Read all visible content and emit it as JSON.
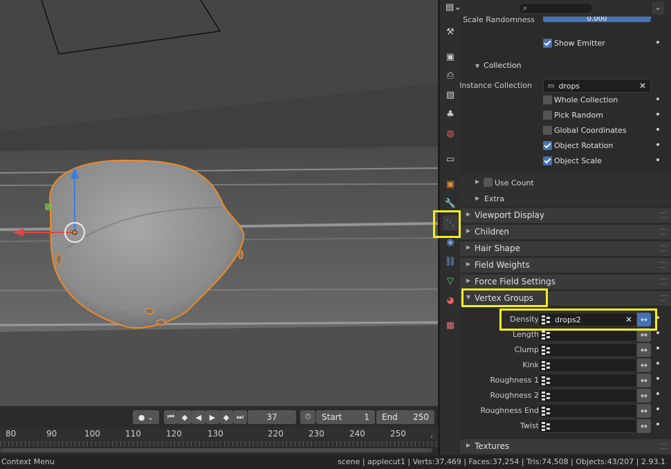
{
  "header": {
    "editor_icon": "properties-editor-icon",
    "search_placeholder": ""
  },
  "props": {
    "scale_randomness_label": "Scale Randomness",
    "scale_randomness_value": "0.000",
    "show_emitter": {
      "label": "Show Emitter",
      "checked": true
    },
    "collection_title": "Collection",
    "instance_collection": {
      "label": "Instance Collection",
      "value": "drops"
    },
    "checks": [
      {
        "label": "Whole Collection",
        "checked": false
      },
      {
        "label": "Pick Random",
        "checked": false
      },
      {
        "label": "Global Coordinates",
        "checked": false
      },
      {
        "label": "Object Rotation",
        "checked": true
      },
      {
        "label": "Object Scale",
        "checked": true
      }
    ],
    "use_count": {
      "label": "Use Count",
      "checked": false
    },
    "extra": "Extra",
    "panels_top": [
      "Viewport Display",
      "Children",
      "Hair Shape",
      "Field Weights",
      "Force Field Settings"
    ],
    "vertex_groups_title": "Vertex Groups",
    "vg_rows": [
      {
        "label": "Density",
        "value": "drops2"
      },
      {
        "label": "Length",
        "value": ""
      },
      {
        "label": "Clump",
        "value": ""
      },
      {
        "label": "Kink",
        "value": ""
      },
      {
        "label": "Roughness 1",
        "value": ""
      },
      {
        "label": "Roughness 2",
        "value": ""
      },
      {
        "label": "Roughness End",
        "value": ""
      },
      {
        "label": "Twist",
        "value": ""
      }
    ],
    "textures": "Textures"
  },
  "timeline": {
    "current_frame": "37",
    "start_label": "Start",
    "start_value": "1",
    "end_label": "End",
    "end_value": "250",
    "ruler": [
      "80",
      "90",
      "100",
      "110",
      "120",
      "130",
      "220",
      "230",
      "240",
      "250"
    ]
  },
  "status": {
    "left": "Context Menu",
    "right": "scene | applecut1 | Verts:37,469 | Faces:37,254 | Tris:74,508 | Objects:43/207 | 2.93.1"
  },
  "colors": {
    "highlight": "#f4ef1a",
    "selection": "#f08a24",
    "accent": "#4772b3"
  }
}
